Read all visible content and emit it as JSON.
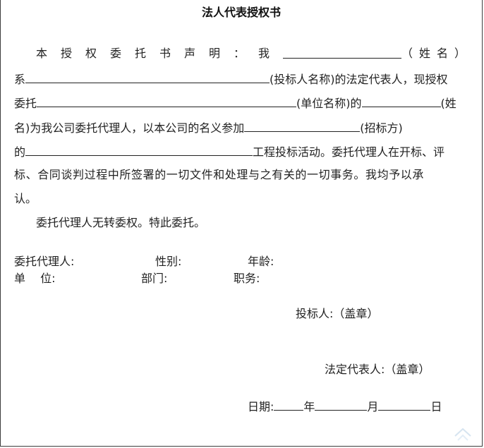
{
  "document": {
    "title": "法人代表授权书",
    "para1": {
      "l1_text": "本授权委托书声明：我",
      "l1_end": "（姓名）",
      "l2_a": "系",
      "l2_b": "(投标人名称)的法定代表人，现授权",
      "l3_a": "委托",
      "l3_b": "(单位名称)的",
      "l3_c": "(姓",
      "l4_a": "名)为我公司委托代理人，以本公司的名义参加",
      "l4_b": "(招标方)",
      "l5_a": "的",
      "l5_b": "工程投标活动。委托代理人在开标、评",
      "l6": "标、合同谈判过程中所签署的一切文件和处理与之有关的一切事务。我均予以承",
      "l7": "认。"
    },
    "para2": "委托代理人无转委权。特此委托。",
    "fields": {
      "agent": "委托代理人:",
      "gender": "性别:",
      "age": "年龄:",
      "unit": "单　 位:",
      "dept": "部门:",
      "position": "职务:"
    },
    "bidder_seal": "投标人:（盖章）",
    "legal_rep_seal": "法定代表人:（盖章）",
    "date": {
      "label": "日期:",
      "year": "年",
      "month": "月",
      "day": "日"
    }
  }
}
